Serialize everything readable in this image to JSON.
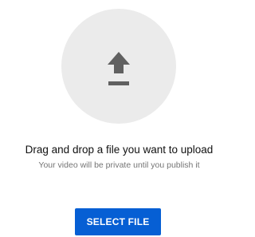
{
  "upload": {
    "icon": "upload-icon",
    "title": "Drag and drop a file you want to upload",
    "subtitle": "Your video will be private until you publish it",
    "button_label": "SELECT FILE"
  },
  "colors": {
    "circle_bg": "#ebebeb",
    "icon": "#606060",
    "button_bg": "#065fd4",
    "button_text": "#ffffff",
    "title_text": "#111111",
    "subtitle_text": "#757575"
  }
}
